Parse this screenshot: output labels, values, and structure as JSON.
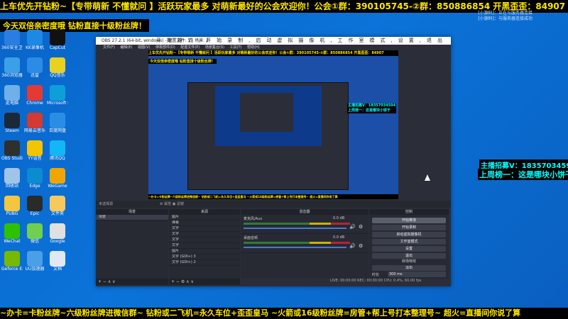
{
  "ticker_top": "上车优先开钻粉~【专带萌新 不懂就问 】活跃玩家最多 对萌新最好的公会欢迎你！公会①群：390105745-②群：850886854 开黑歪歪：84907",
  "subline": "今天双倍亲密度哦 钻粉直接十级粉丝牌！",
  "notice": [
    "[小源码]：正在与服务器连接",
    "[小源码]：与服务器连接成功"
  ],
  "ticker_bottom": "~办卡=卡粉丝牌~六级粉丝牌进微信群~ 钻粉或二飞机=永久车位+歪歪皇马 ~火箭或16级粉丝牌=房管+帮上号打本整理号~ 超火=直播间你说了算",
  "side_a": "主播招募V：18357034594",
  "side_b": "上周榜一：这是哪块小饼干",
  "desktop_icons": [
    {
      "label": "360安全卫士",
      "color": "#2a7de1"
    },
    {
      "label": "KK录像机",
      "color": "#1e88e5"
    },
    {
      "label": "CapCut",
      "color": "#111111"
    },
    {
      "label": "360浏览器",
      "color": "#3ca0e8"
    },
    {
      "label": "迅雷",
      "color": "#2b8be6"
    },
    {
      "label": "QQ音乐",
      "color": "#e9d021"
    },
    {
      "label": "此电脑",
      "color": "#6fb0e8"
    },
    {
      "label": "Chrome",
      "color": "#e53935"
    },
    {
      "label": "Microsoft Edge",
      "color": "#0f9fd8"
    },
    {
      "label": "Steam",
      "color": "#1b2838"
    },
    {
      "label": "网易云音乐",
      "color": "#d33a31"
    },
    {
      "label": "百度网盘",
      "color": "#2a8ee6"
    },
    {
      "label": "OBS Studio",
      "color": "#2f2f2f"
    },
    {
      "label": "YY语音",
      "color": "#f2c500"
    },
    {
      "label": "腾讯QQ",
      "color": "#12b7f5"
    },
    {
      "label": "回收站",
      "color": "#9fc4e8"
    },
    {
      "label": "Edge",
      "color": "#0c8bd1"
    },
    {
      "label": "WeGame",
      "color": "#f0a500"
    },
    {
      "label": "PUBG",
      "color": "#f3c63f"
    },
    {
      "label": "Epic",
      "color": "#2a2a2a"
    },
    {
      "label": "文件夹",
      "color": "#f7c85b"
    },
    {
      "label": "WeChat",
      "color": "#2dc100"
    },
    {
      "label": "微信",
      "color": "#6fd04f"
    },
    {
      "label": "Google",
      "color": "#e0e0e0"
    },
    {
      "label": "Geforce Experience",
      "color": "#76b900"
    },
    {
      "label": "UU加速器",
      "color": "#4aa0e6"
    },
    {
      "label": "文档",
      "color": "#dfe8f3"
    }
  ],
  "obs": {
    "title": "OBS 27.2.1 (64-bit, windows) - 配置文件: 1 - 场景: 2",
    "controls": [
      "开始推流",
      "开始录制",
      "启动虚拟摄像机",
      "工作室模式",
      "设置",
      "退出"
    ],
    "menu": [
      "文件(F)",
      "编辑(E)",
      "视图(V)",
      "停靠部件(D)",
      "配置文件(P)",
      "场景集合(S)",
      "工具(T)",
      "帮助(H)"
    ],
    "preview_ticker": "上车优先开钻粉~【专带萌新 不懂就问 】活跃玩家最多 对萌新最好的公会欢迎你！公会①群：390105745-②群：850886854 开黑歪歪：84907",
    "preview_sub": "今天双倍亲密度哦 钻粉直接十级粉丝牌！",
    "preview_side": [
      "主播招募V：18357034594",
      "上周榜一：这是哪块小饼干"
    ],
    "preview_bottom": "~办卡=卡粉丝牌~六级粉丝牌进微信群~ 钻粉或二飞机=永久车位+歪歪皇马 ~火箭或16级粉丝牌=房管+帮上号打本整理号~ 超火=直播间你说了算",
    "no_source": "未选择源",
    "status_tabs": "⚙ 属性   ▣ 滤镜",
    "docks": {
      "scenes": "场景",
      "sources": "来源",
      "mixer": "混音器",
      "transitions": "转场特效",
      "controls": "控制"
    },
    "scenes": [
      "场景"
    ],
    "sources": [
      "图片",
      "弹幕",
      "文字",
      "文字",
      "文字",
      "文字",
      "图片",
      "文字 (GDI+) 3",
      "文字 (GDI+) 2"
    ],
    "mixer": [
      {
        "name": "麦克风/Aux",
        "level": "0.0 dB"
      },
      {
        "name": "桌面音频",
        "level": "0.0 dB"
      }
    ],
    "transition": {
      "type": "淡出",
      "duration_label": "时长",
      "duration": "300 ms"
    },
    "footer": "LIVE: 00:00:00   REC: 00:00:00   CPU: 0.4%, 60.00 fps"
  }
}
